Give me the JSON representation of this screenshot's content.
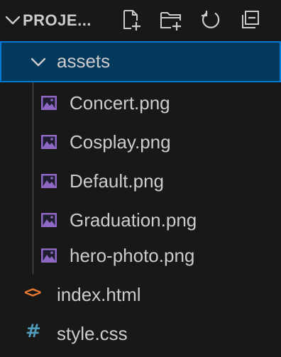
{
  "explorer": {
    "section_title": "PROJE...",
    "actions": [
      {
        "name": "new-file",
        "icon": "new-file-icon"
      },
      {
        "name": "new-folder",
        "icon": "new-folder-icon"
      },
      {
        "name": "refresh",
        "icon": "refresh-icon"
      },
      {
        "name": "collapse-all",
        "icon": "collapse-all-icon"
      }
    ],
    "folder": {
      "label": "assets",
      "expanded": true,
      "selected": true,
      "files": [
        {
          "label": "Concert.png",
          "icon": "image-file-icon"
        },
        {
          "label": "Cosplay.png",
          "icon": "image-file-icon"
        },
        {
          "label": "Default.png",
          "icon": "image-file-icon"
        },
        {
          "label": "Graduation.png",
          "icon": "image-file-icon"
        },
        {
          "label": "hero-photo.png",
          "icon": "image-file-icon"
        }
      ]
    },
    "root_files": [
      {
        "label": "index.html",
        "icon": "html-file-icon",
        "icon_glyph": "<>"
      },
      {
        "label": "style.css",
        "icon": "css-file-icon",
        "icon_glyph": "#"
      }
    ]
  },
  "colors": {
    "background": "#181818",
    "selected_background": "#04395e",
    "focus_outline": "#0078d4",
    "text": "#cccccc",
    "image_icon": "#8f67c5",
    "html_icon": "#e37933",
    "css_icon": "#519aba"
  }
}
